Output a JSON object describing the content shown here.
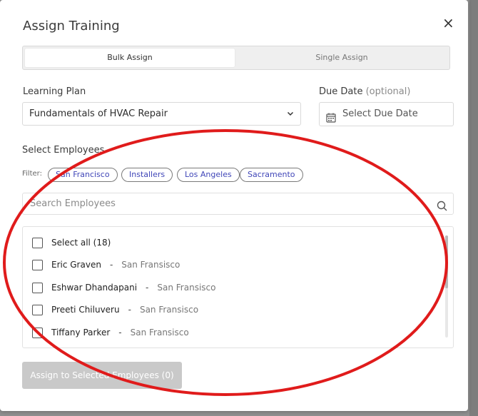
{
  "modal": {
    "title": "Assign Training",
    "close_glyph": "×"
  },
  "mode_toggle": {
    "options": [
      {
        "label": "Bulk Assign",
        "active": true
      },
      {
        "label": "Single Assign",
        "active": false
      }
    ]
  },
  "learning_plan": {
    "label": "Learning Plan",
    "value": "Fundamentals of HVAC Repair",
    "icon": "chevron-down-icon"
  },
  "due_date": {
    "label": "Due Date",
    "optional": "(optional)",
    "placeholder": "Select Due Date",
    "icon": "calendar-icon"
  },
  "employees": {
    "label": "Select Employees",
    "filter_label": "Filter:",
    "filters": [
      "San Francisco",
      "Installers",
      "Los Angeles",
      "Sacramento"
    ],
    "search_placeholder": "Search Employees",
    "select_all": "Select all (18)",
    "list": [
      {
        "name": "Eric Graven",
        "location": "San Fransisco"
      },
      {
        "name": "Eshwar Dhandapani",
        "location": "San Fransisco"
      },
      {
        "name": "Preeti Chiluveru",
        "location": "San Fransisco"
      },
      {
        "name": "Tiffany Parker",
        "location": "San Fransisco"
      }
    ],
    "separator": "-"
  },
  "assign_button": "Assign to Selected Employees (0)",
  "colors": {
    "accent_chip_text": "#4046b8",
    "annotation_ellipse": "#e01b1b",
    "disabled_button": "#c9c9c9"
  }
}
